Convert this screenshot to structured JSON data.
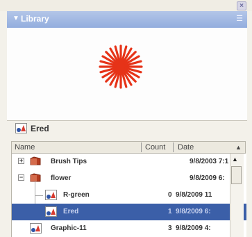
{
  "panel": {
    "title": "Library",
    "collapse_icon": "triangle-down-icon",
    "options_icon": "panel-options-icon",
    "close_symbol": "×"
  },
  "selected_item": {
    "name": "Ered",
    "icon": "graphic-symbol-icon"
  },
  "columns": {
    "name": "Name",
    "count": "Count",
    "date": "Date",
    "sort_symbol": "▲"
  },
  "rows": [
    {
      "name": "Brush Tips",
      "count": "",
      "date": "9/8/2003 7:1",
      "type": "folder",
      "expander": "+"
    },
    {
      "name": "flower",
      "count": "",
      "date": "9/8/2009 6:",
      "type": "folder",
      "expander": "−"
    },
    {
      "name": "R-green",
      "count": "0",
      "date": "9/8/2009 11",
      "type": "graphic"
    },
    {
      "name": "Ered",
      "count": "1",
      "date": "9/8/2009 6:",
      "type": "graphic",
      "selected": true
    },
    {
      "name": "Graphic-11",
      "count": "3",
      "date": "9/8/2009 4:",
      "type": "graphic"
    }
  ],
  "colors": {
    "title_bar": "#9db5e3",
    "flower": "#e63318",
    "selection": "#3b5fa8"
  }
}
